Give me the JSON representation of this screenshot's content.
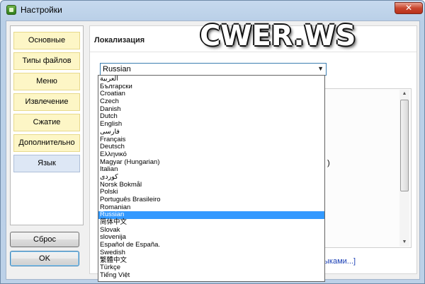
{
  "window": {
    "title": "Настройки",
    "close_label": "✕"
  },
  "nav": {
    "items": [
      {
        "label": "Основные",
        "active": false
      },
      {
        "label": "Типы файлов",
        "active": false
      },
      {
        "label": "Меню",
        "active": false
      },
      {
        "label": "Извлечение",
        "active": false
      },
      {
        "label": "Сжатие",
        "active": false
      },
      {
        "label": "Дополнительно",
        "active": false
      },
      {
        "label": "Язык",
        "active": true
      }
    ],
    "reset_label": "Сброс",
    "ok_label": "OK"
  },
  "section": {
    "title": "Локализация"
  },
  "language_combo": {
    "value": "Russian",
    "arrow_icon": "chevron-down-icon"
  },
  "dropdown": {
    "options": [
      "العربية",
      "Български",
      "Croatian",
      "Czech",
      "Danish",
      "Dutch",
      "English",
      "فارسی",
      "Français",
      "Deutsch",
      "Ελληνικό",
      "Magyar (Hungarian)",
      "Italian",
      "کوردی",
      "Norsk Bokmål",
      "Polski",
      "Português Brasileiro",
      "Romanian",
      "Russian",
      "简体中文",
      "Slovak",
      "slovenija",
      "Español de España.",
      "Swedish",
      "繁體中文",
      "Türkçe",
      "Tiếng Việt"
    ],
    "selected": "Russian"
  },
  "partial_text": {
    "paren": ")",
    "link": "языками...]"
  },
  "watermark": {
    "text": "CWER.WS"
  },
  "colors": {
    "selection": "#3399ff",
    "nav_item_bg": "#fdf6c6",
    "nav_active_bg": "#dde7f5",
    "link": "#1a3fb5"
  }
}
